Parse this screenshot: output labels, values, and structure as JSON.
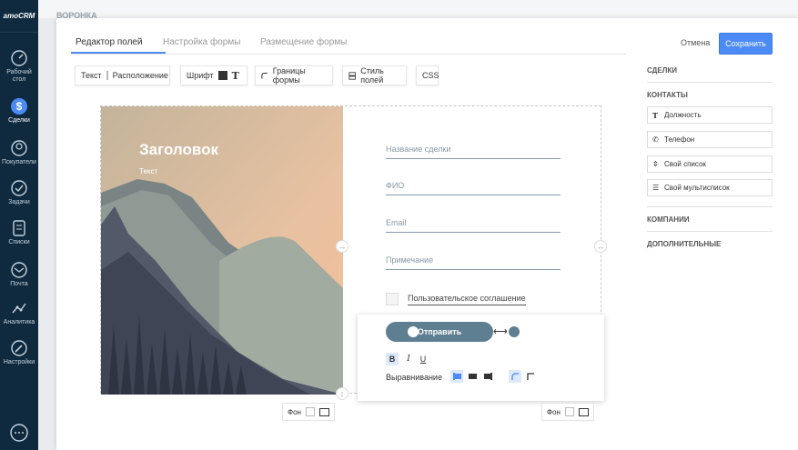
{
  "nav": {
    "logo": "amoCRM",
    "items": [
      {
        "label": "Рабочий стол",
        "icon": "speedometer-icon"
      },
      {
        "label": "Сделки",
        "icon": "dollar-icon"
      },
      {
        "label": "Покупатели",
        "icon": "customers-icon"
      },
      {
        "label": "Задачи",
        "icon": "check-icon"
      },
      {
        "label": "Списки",
        "icon": "lists-icon"
      },
      {
        "label": "Почта",
        "icon": "mail-icon"
      },
      {
        "label": "Аналитика",
        "icon": "analytics-icon"
      },
      {
        "label": "Настройки",
        "icon": "wrench-icon"
      }
    ]
  },
  "background": {
    "title": "ВОРОНКА"
  },
  "tabs": [
    "Редактор полей",
    "Настройка формы",
    "Размещение формы"
  ],
  "actions": {
    "cancel": "Отмена",
    "save": "Сохранить"
  },
  "toolbar": {
    "text": "Текст",
    "layout": "Расположение",
    "font": "Шрифт",
    "font_glyph": "T",
    "borders": "Границы формы",
    "field_style": "Стиль полей",
    "css": "CSS"
  },
  "form": {
    "heading": "Заголовок",
    "subheading": "Текст",
    "fields": [
      "Название сделки",
      "ФИО",
      "Email",
      "Примечание"
    ],
    "agreement": "Пользовательское соглашение",
    "submit": "Отправить"
  },
  "popover": {
    "bold": "B",
    "italic": "I",
    "underline": "U",
    "align_label": "Выравнивание",
    "button_color": "#5e7e91"
  },
  "bottom": {
    "bg_label_left": "Фон",
    "bg_label_right": "Фон"
  },
  "right_panel": {
    "deals": "СДЕЛКИ",
    "contacts": "КОНТАКТЫ",
    "contact_fields": [
      {
        "icon": "T",
        "label": "Должность"
      },
      {
        "icon": "✆",
        "label": "Телефон"
      },
      {
        "icon": "⇕",
        "label": "Свой список"
      },
      {
        "icon": "☰",
        "label": "Свой мультисписок"
      }
    ],
    "companies": "КОМПАНИИ",
    "additional": "ДОПОЛНИТЕЛЬНЫЕ"
  },
  "colors": {
    "accent": "#4c8bf5",
    "nav_bg": "#0f2a3e"
  }
}
